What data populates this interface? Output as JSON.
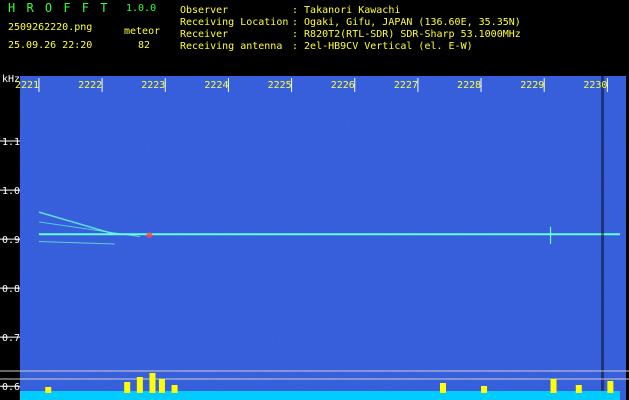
{
  "app": {
    "title": "H R O F F T",
    "version": "1.0.0",
    "filename": "2509262220.png",
    "datetime": "25.09.26 22:20",
    "meteor_label": "meteor",
    "meteor_count": "82"
  },
  "info": [
    {
      "key": "Observer",
      "value": ": Takanori Kawachi"
    },
    {
      "key": "Receiving Location",
      "value": ": Ogaki, Gifu, JAPAN (136.60E, 35.35N)"
    },
    {
      "key": "Receiver",
      "value": ": R820T2(RTL-SDR) SDR-Sharp 53.1000MHz"
    },
    {
      "key": "Receiving antenna",
      "value": ": 2el-HB9CV Vertical (el. E-W)"
    }
  ],
  "chart_data": {
    "type": "heatmap",
    "ylabel": "kHz",
    "y_ticks": [
      "1.1",
      "1.0",
      "0.9",
      "0.8",
      "0.7",
      "0.6"
    ],
    "y_range": [
      0.58,
      1.2
    ],
    "x_ticks": [
      "2221",
      "2222",
      "2223",
      "2224",
      "2225",
      "2226",
      "2227",
      "2228",
      "2229",
      "2230"
    ],
    "x_range": [
      2220.7,
      2230.2
    ],
    "carrier_khz": 0.91,
    "colors": {
      "background": "#0a1aa0",
      "carrier": "#66ffdd",
      "tick_text": "#ffff33",
      "spike": "#ffff00",
      "baseline": "#00ccff"
    }
  }
}
